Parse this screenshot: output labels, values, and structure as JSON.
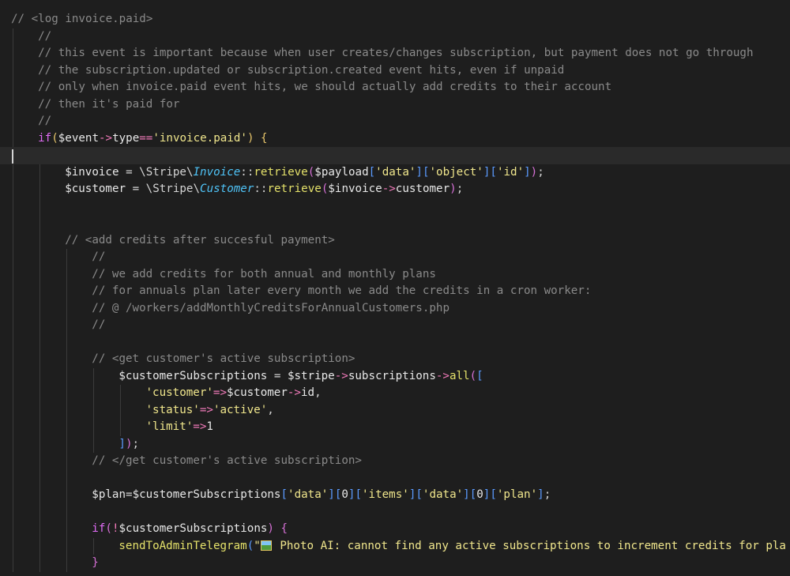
{
  "colors": {
    "background": "#1e1e1e",
    "comment": "#8a8a8a",
    "default": "#d4d4d4",
    "variable": "#e8e8e8",
    "string": "#f0e68c",
    "operator": "#f07ab9",
    "keyword": "#e06cf5",
    "function": "#e5e26a",
    "class_italic": "#4fc3f7",
    "bracket_blue": "#5b9bff",
    "bracket_gold": "#e8c66b",
    "bracket_pink": "#d670d6",
    "number": "#e8e8e8"
  },
  "lines": [
    {
      "indent": 0,
      "tokens": [
        {
          "c": "comment",
          "t": "// <log invoice.paid>"
        }
      ]
    },
    {
      "indent": 1,
      "tokens": [
        {
          "c": "comment",
          "t": "//"
        }
      ]
    },
    {
      "indent": 1,
      "tokens": [
        {
          "c": "comment",
          "t": "// this event is important because when user creates/changes subscription, but payment does not go through"
        }
      ]
    },
    {
      "indent": 1,
      "tokens": [
        {
          "c": "comment",
          "t": "// the subscription.updated or subscription.created event hits, even if unpaid"
        }
      ]
    },
    {
      "indent": 1,
      "tokens": [
        {
          "c": "comment",
          "t": "// only when invoice.paid event hits, we should actually add credits to their account"
        }
      ]
    },
    {
      "indent": 1,
      "tokens": [
        {
          "c": "comment",
          "t": "// then it's paid for"
        }
      ]
    },
    {
      "indent": 1,
      "tokens": [
        {
          "c": "comment",
          "t": "//"
        }
      ]
    },
    {
      "indent": 1,
      "tokens": [
        {
          "c": "keyword",
          "t": "if"
        },
        {
          "c": "bracket_gold",
          "t": "("
        },
        {
          "c": "variable",
          "t": "$event"
        },
        {
          "c": "operator",
          "t": "->"
        },
        {
          "c": "variable",
          "t": "type"
        },
        {
          "c": "operator",
          "t": "=="
        },
        {
          "c": "string",
          "t": "'invoice.paid'"
        },
        {
          "c": "bracket_gold",
          "t": ")"
        },
        {
          "c": "default",
          "t": " "
        },
        {
          "c": "bracket_gold",
          "t": "{"
        }
      ]
    },
    {
      "indent": 0,
      "tokens": [],
      "current": true
    },
    {
      "indent": 2,
      "tokens": [
        {
          "c": "variable",
          "t": "$invoice"
        },
        {
          "c": "default",
          "t": " = \\Stripe\\"
        },
        {
          "c": "class_italic",
          "t": "Invoice"
        },
        {
          "c": "default",
          "t": "::"
        },
        {
          "c": "function",
          "t": "retrieve"
        },
        {
          "c": "bracket_pink",
          "t": "("
        },
        {
          "c": "variable",
          "t": "$payload"
        },
        {
          "c": "bracket_blue",
          "t": "["
        },
        {
          "c": "string",
          "t": "'data'"
        },
        {
          "c": "bracket_blue",
          "t": "]["
        },
        {
          "c": "string",
          "t": "'object'"
        },
        {
          "c": "bracket_blue",
          "t": "]["
        },
        {
          "c": "string",
          "t": "'id'"
        },
        {
          "c": "bracket_blue",
          "t": "]"
        },
        {
          "c": "bracket_pink",
          "t": ")"
        },
        {
          "c": "default",
          "t": ";"
        }
      ]
    },
    {
      "indent": 2,
      "tokens": [
        {
          "c": "variable",
          "t": "$customer"
        },
        {
          "c": "default",
          "t": " = \\Stripe\\"
        },
        {
          "c": "class_italic",
          "t": "Customer"
        },
        {
          "c": "default",
          "t": "::"
        },
        {
          "c": "function",
          "t": "retrieve"
        },
        {
          "c": "bracket_pink",
          "t": "("
        },
        {
          "c": "variable",
          "t": "$invoice"
        },
        {
          "c": "operator",
          "t": "->"
        },
        {
          "c": "variable",
          "t": "customer"
        },
        {
          "c": "bracket_pink",
          "t": ")"
        },
        {
          "c": "default",
          "t": ";"
        }
      ]
    },
    {
      "indent": 0,
      "tokens": []
    },
    {
      "indent": 0,
      "tokens": []
    },
    {
      "indent": 2,
      "tokens": [
        {
          "c": "comment",
          "t": "// <add credits after succesful payment>"
        }
      ]
    },
    {
      "indent": 3,
      "tokens": [
        {
          "c": "comment",
          "t": "//"
        }
      ]
    },
    {
      "indent": 3,
      "tokens": [
        {
          "c": "comment",
          "t": "// we add credits for both annual and monthly plans"
        }
      ]
    },
    {
      "indent": 3,
      "tokens": [
        {
          "c": "comment",
          "t": "// for annuals plan later every month we add the credits in a cron worker:"
        }
      ]
    },
    {
      "indent": 3,
      "tokens": [
        {
          "c": "comment",
          "t": "// @ /workers/addMonthlyCreditsForAnnualCustomers.php"
        }
      ]
    },
    {
      "indent": 3,
      "tokens": [
        {
          "c": "comment",
          "t": "//"
        }
      ]
    },
    {
      "indent": 0,
      "tokens": []
    },
    {
      "indent": 3,
      "tokens": [
        {
          "c": "comment",
          "t": "// <get customer's active subscription>"
        }
      ]
    },
    {
      "indent": 4,
      "tokens": [
        {
          "c": "variable",
          "t": "$customerSubscriptions"
        },
        {
          "c": "default",
          "t": " = "
        },
        {
          "c": "variable",
          "t": "$stripe"
        },
        {
          "c": "operator",
          "t": "->"
        },
        {
          "c": "variable",
          "t": "subscriptions"
        },
        {
          "c": "operator",
          "t": "->"
        },
        {
          "c": "function",
          "t": "all"
        },
        {
          "c": "bracket_pink",
          "t": "("
        },
        {
          "c": "bracket_blue",
          "t": "["
        }
      ]
    },
    {
      "indent": 5,
      "tokens": [
        {
          "c": "string",
          "t": "'customer'"
        },
        {
          "c": "operator",
          "t": "=>"
        },
        {
          "c": "variable",
          "t": "$customer"
        },
        {
          "c": "operator",
          "t": "->"
        },
        {
          "c": "variable",
          "t": "id"
        },
        {
          "c": "default",
          "t": ","
        }
      ]
    },
    {
      "indent": 5,
      "tokens": [
        {
          "c": "string",
          "t": "'status'"
        },
        {
          "c": "operator",
          "t": "=>"
        },
        {
          "c": "string",
          "t": "'active'"
        },
        {
          "c": "default",
          "t": ","
        }
      ]
    },
    {
      "indent": 5,
      "tokens": [
        {
          "c": "string",
          "t": "'limit'"
        },
        {
          "c": "operator",
          "t": "=>"
        },
        {
          "c": "number",
          "t": "1"
        }
      ]
    },
    {
      "indent": 4,
      "tokens": [
        {
          "c": "bracket_blue",
          "t": "]"
        },
        {
          "c": "bracket_pink",
          "t": ")"
        },
        {
          "c": "default",
          "t": ";"
        }
      ]
    },
    {
      "indent": 3,
      "tokens": [
        {
          "c": "comment",
          "t": "// </get customer's active subscription>"
        }
      ]
    },
    {
      "indent": 0,
      "tokens": []
    },
    {
      "indent": 3,
      "tokens": [
        {
          "c": "variable",
          "t": "$plan"
        },
        {
          "c": "default",
          "t": "="
        },
        {
          "c": "variable",
          "t": "$customerSubscriptions"
        },
        {
          "c": "bracket_blue",
          "t": "["
        },
        {
          "c": "string",
          "t": "'data'"
        },
        {
          "c": "bracket_blue",
          "t": "]["
        },
        {
          "c": "number",
          "t": "0"
        },
        {
          "c": "bracket_blue",
          "t": "]["
        },
        {
          "c": "string",
          "t": "'items'"
        },
        {
          "c": "bracket_blue",
          "t": "]["
        },
        {
          "c": "string",
          "t": "'data'"
        },
        {
          "c": "bracket_blue",
          "t": "]["
        },
        {
          "c": "number",
          "t": "0"
        },
        {
          "c": "bracket_blue",
          "t": "]["
        },
        {
          "c": "string",
          "t": "'plan'"
        },
        {
          "c": "bracket_blue",
          "t": "]"
        },
        {
          "c": "default",
          "t": ";"
        }
      ]
    },
    {
      "indent": 0,
      "tokens": []
    },
    {
      "indent": 3,
      "tokens": [
        {
          "c": "keyword",
          "t": "if"
        },
        {
          "c": "bracket_pink",
          "t": "("
        },
        {
          "c": "operator",
          "t": "!"
        },
        {
          "c": "variable",
          "t": "$customerSubscriptions"
        },
        {
          "c": "bracket_pink",
          "t": ")"
        },
        {
          "c": "default",
          "t": " "
        },
        {
          "c": "bracket_pink",
          "t": "{"
        }
      ]
    },
    {
      "indent": 4,
      "tokens": [
        {
          "c": "function",
          "t": "sendToAdminTelegram"
        },
        {
          "c": "bracket_blue",
          "t": "("
        },
        {
          "c": "string",
          "t": "\""
        },
        {
          "c": "icon",
          "t": "framed-picture-icon"
        },
        {
          "c": "string",
          "t": " Photo AI: cannot find any active subscriptions to increment credits for pla"
        }
      ]
    },
    {
      "indent": 3,
      "tokens": [
        {
          "c": "bracket_pink",
          "t": "}"
        }
      ]
    }
  ]
}
